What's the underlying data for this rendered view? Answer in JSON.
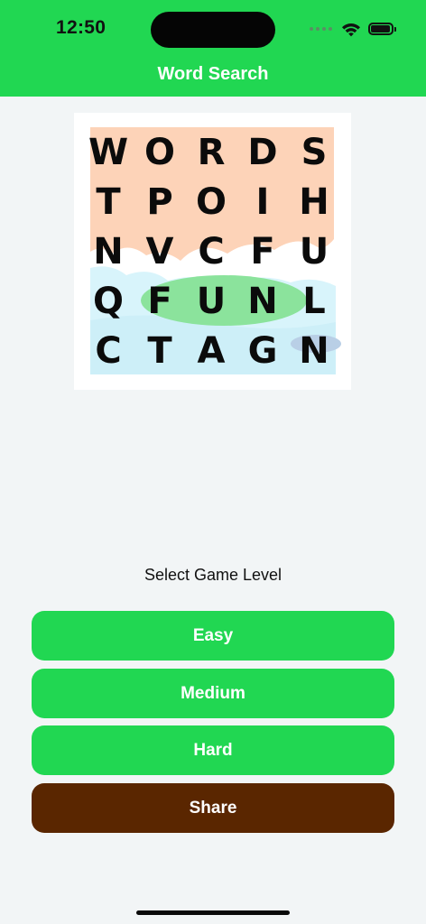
{
  "status_bar": {
    "time": "12:50",
    "icons": [
      "cellular-dots-icon",
      "wifi-icon",
      "battery-icon"
    ]
  },
  "nav": {
    "title": "Word Search"
  },
  "logo": {
    "rows": [
      [
        "W",
        "O",
        "R",
        "D",
        "S"
      ],
      [
        "T",
        "P",
        "O",
        "I",
        "H"
      ],
      [
        "N",
        "V",
        "C",
        "F",
        "U"
      ],
      [
        "Q",
        "F",
        "U",
        "N",
        "L"
      ],
      [
        "C",
        "T",
        "A",
        "G",
        "N"
      ]
    ],
    "colors": {
      "top_band": "#fdd3b8",
      "bottom_band": "#d8f4fb",
      "highlight": "#8be39c"
    }
  },
  "level_prompt": "Select Game Level",
  "buttons": {
    "easy": "Easy",
    "medium": "Medium",
    "hard": "Hard",
    "share": "Share"
  },
  "colors": {
    "accent": "#21d752",
    "share": "#5a2600",
    "background": "#f2f5f6"
  }
}
